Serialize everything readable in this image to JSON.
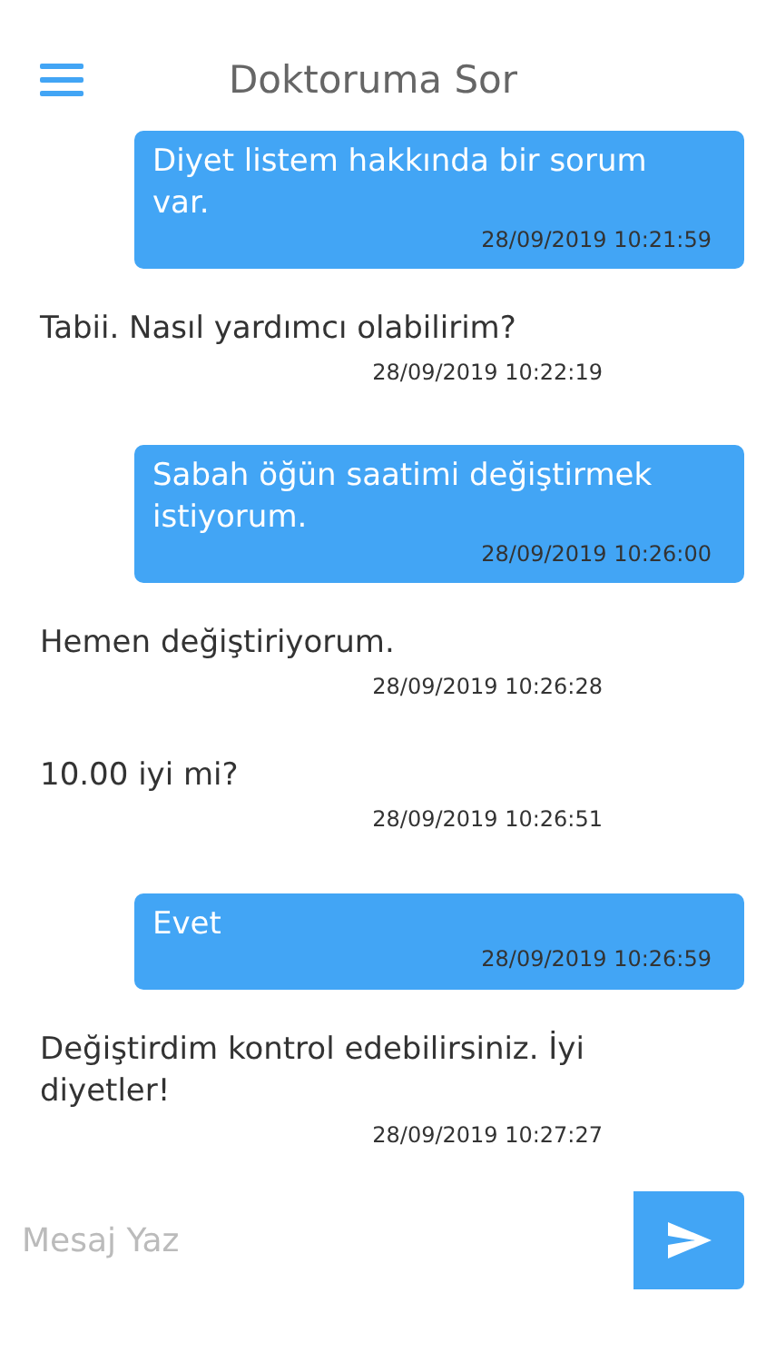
{
  "header": {
    "title": "Doktoruma Sor"
  },
  "messages": [
    {
      "kind": "sent",
      "text": "Diyet listem hakkında bir sorum var.",
      "time": "28/09/2019 10:21:59"
    },
    {
      "kind": "received",
      "text": "Tabii. Nasıl yardımcı olabilirim?",
      "time": "28/09/2019 10:22:19"
    },
    {
      "kind": "sent",
      "text": "Sabah öğün saatimi değiştirmek istiyorum.",
      "time": "28/09/2019 10:26:00"
    },
    {
      "kind": "received",
      "text": "Hemen değiştiriyorum.",
      "time": "28/09/2019 10:26:28"
    },
    {
      "kind": "received",
      "text": "10.00 iyi mi?",
      "time": "28/09/2019 10:26:51"
    },
    {
      "kind": "sent",
      "text": "Evet",
      "time": "28/09/2019 10:26:59"
    },
    {
      "kind": "received",
      "text": "Değiştirdim kontrol edebilirsiniz. İyi diyetler!",
      "time": "28/09/2019 10:27:27"
    }
  ],
  "composer": {
    "placeholder": "Mesaj Yaz"
  }
}
